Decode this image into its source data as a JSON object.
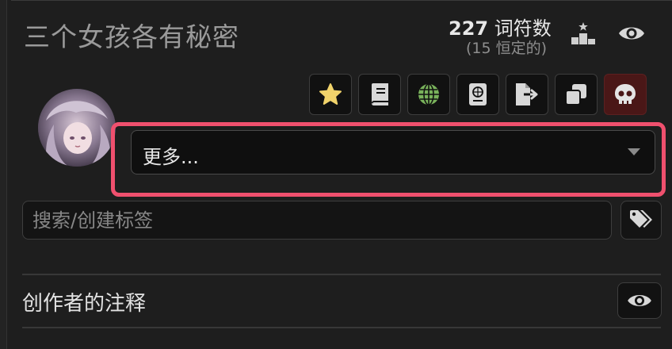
{
  "header": {
    "title": "三个女孩各有秘密",
    "token_count": "227",
    "token_label": "词符数",
    "permanent_tokens": "(15 恒定的)"
  },
  "icons": {
    "rank": "ranking-podium-icon",
    "eye": "eye-icon",
    "favorite": "star-icon",
    "book": "book-icon",
    "globe": "globe-icon",
    "passport": "passport-icon",
    "export": "file-export-icon",
    "duplicate": "clone-icon",
    "delete": "skull-icon",
    "tags": "tags-icon"
  },
  "colors": {
    "highlight": "#f0506e",
    "star": "#f1d36b",
    "globe": "#79b25b",
    "danger_bg": "#4a1717"
  },
  "more_select": {
    "value": "更多..."
  },
  "tag_search": {
    "placeholder": "搜索/创建标签"
  },
  "creator_notes": {
    "label": "创作者的注释"
  }
}
